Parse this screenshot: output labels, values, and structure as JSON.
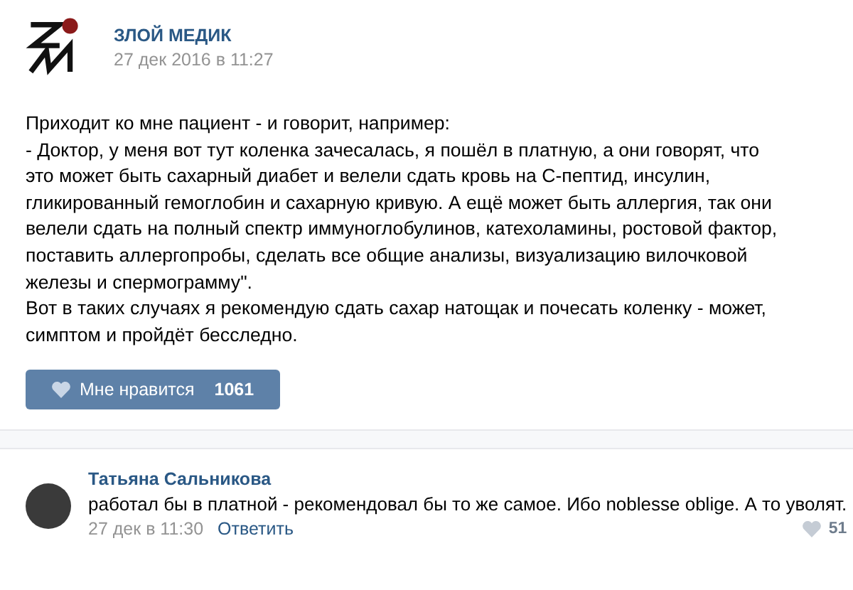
{
  "post": {
    "author": "ЗЛОЙ МЕДИК",
    "date": "27 дек 2016 в 11:27",
    "lines": [
      "Приходит ко мне пациент - и говорит, например:",
      "- Доктор, у меня вот тут коленка зачесалась, я пошёл в платную, а они говорят, что",
      "это может быть сахарный диабет и велели сдать кровь на С-пептид, инсулин,",
      "гликированный гемоглобин и сахарную кривую. А ещё может быть аллергия, так они",
      "велели сдать на полный спектр иммуноглобулинов, катехоламины, ростовой фактор,",
      "поставить аллергопробы, сделать все общие анализы, визуализацию вилочковой",
      "железы и спермограмму\".",
      "Вот в таких случаях я рекомендую сдать сахар натощак и почесать коленку - может,",
      "симптом и пройдёт бесследно."
    ],
    "like": {
      "label": "Мне нравится",
      "count": "1061"
    }
  },
  "comment": {
    "author": "Татьяна Сальникова",
    "text": "работал бы в платной - рекомендовал бы то же самое. Ибо noblesse oblige. А то уволят.",
    "date": "27 дек в 11:30",
    "reply": "Ответить",
    "likes": "51"
  }
}
